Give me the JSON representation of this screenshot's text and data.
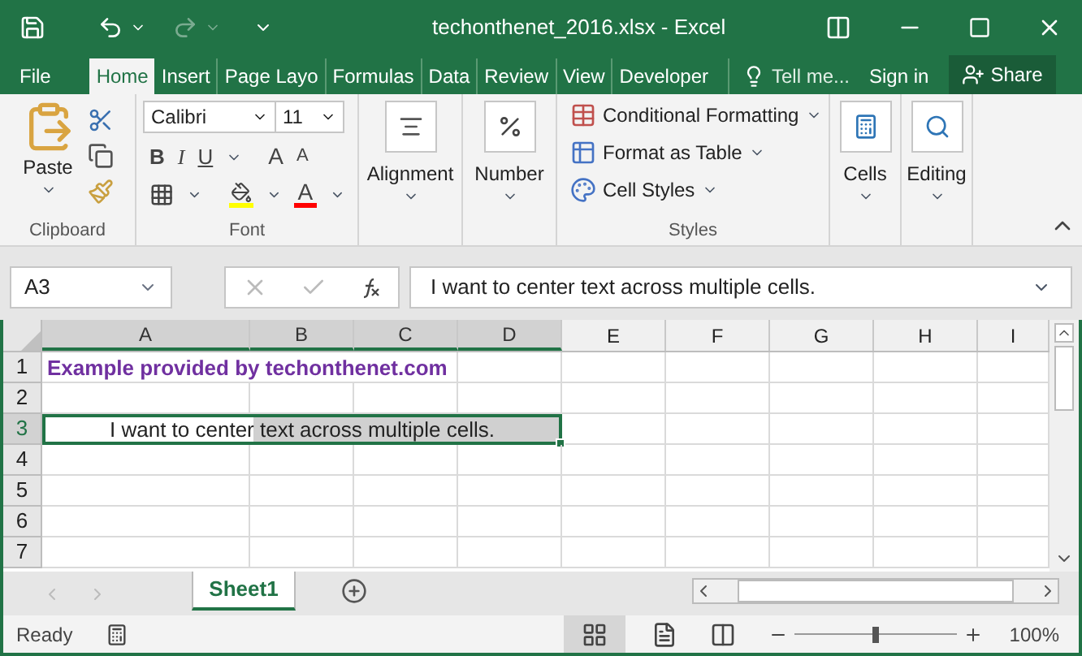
{
  "window": {
    "title": "techonthenet_2016.xlsx - Excel"
  },
  "ribbon_tabs": [
    {
      "label": "File",
      "selected": false
    },
    {
      "label": "Home",
      "selected": true
    },
    {
      "label": "Insert",
      "selected": false
    },
    {
      "label": "Page Layo",
      "selected": false
    },
    {
      "label": "Formulas",
      "selected": false
    },
    {
      "label": "Data",
      "selected": false
    },
    {
      "label": "Review",
      "selected": false
    },
    {
      "label": "View",
      "selected": false
    },
    {
      "label": "Developer",
      "selected": false
    }
  ],
  "tell_me": "Tell me...",
  "sign_in": "Sign in",
  "share": "Share",
  "clipboard": {
    "paste": "Paste",
    "label": "Clipboard"
  },
  "font": {
    "name": "Calibri",
    "size": "11",
    "bold": "B",
    "italic": "I",
    "underline": "U",
    "grow": "A",
    "shrink": "A",
    "font_color": "A",
    "label": "Font"
  },
  "alignment": {
    "label": "Alignment"
  },
  "number": {
    "label": "Number"
  },
  "styles": {
    "items": [
      "Conditional Formatting",
      "Format as Table",
      "Cell Styles"
    ],
    "label": "Styles"
  },
  "cells": {
    "label": "Cells"
  },
  "editing": {
    "label": "Editing"
  },
  "name_box": "A3",
  "formula": "I want to center text across multiple cells.",
  "columns": [
    {
      "label": "A",
      "selected": true
    },
    {
      "label": "B",
      "selected": true
    },
    {
      "label": "C",
      "selected": true
    },
    {
      "label": "D",
      "selected": true
    },
    {
      "label": "E",
      "selected": false
    },
    {
      "label": "F",
      "selected": false
    },
    {
      "label": "G",
      "selected": false
    },
    {
      "label": "H",
      "selected": false
    },
    {
      "label": "I",
      "selected": false
    }
  ],
  "rows": [
    {
      "label": "1",
      "selected": false,
      "kind": "title",
      "text": "Example provided by techonthenet.com"
    },
    {
      "label": "2",
      "selected": false
    },
    {
      "label": "3",
      "selected": true,
      "kind": "centered",
      "text": "I want to center text across multiple cells."
    },
    {
      "label": "4",
      "selected": false
    },
    {
      "label": "5",
      "selected": false
    },
    {
      "label": "6",
      "selected": false
    },
    {
      "label": "7",
      "selected": false
    }
  ],
  "sheets": [
    {
      "label": "Sheet1",
      "selected": true
    }
  ],
  "status": "Ready",
  "zoom": {
    "level": 0.5,
    "reading": "100%"
  }
}
